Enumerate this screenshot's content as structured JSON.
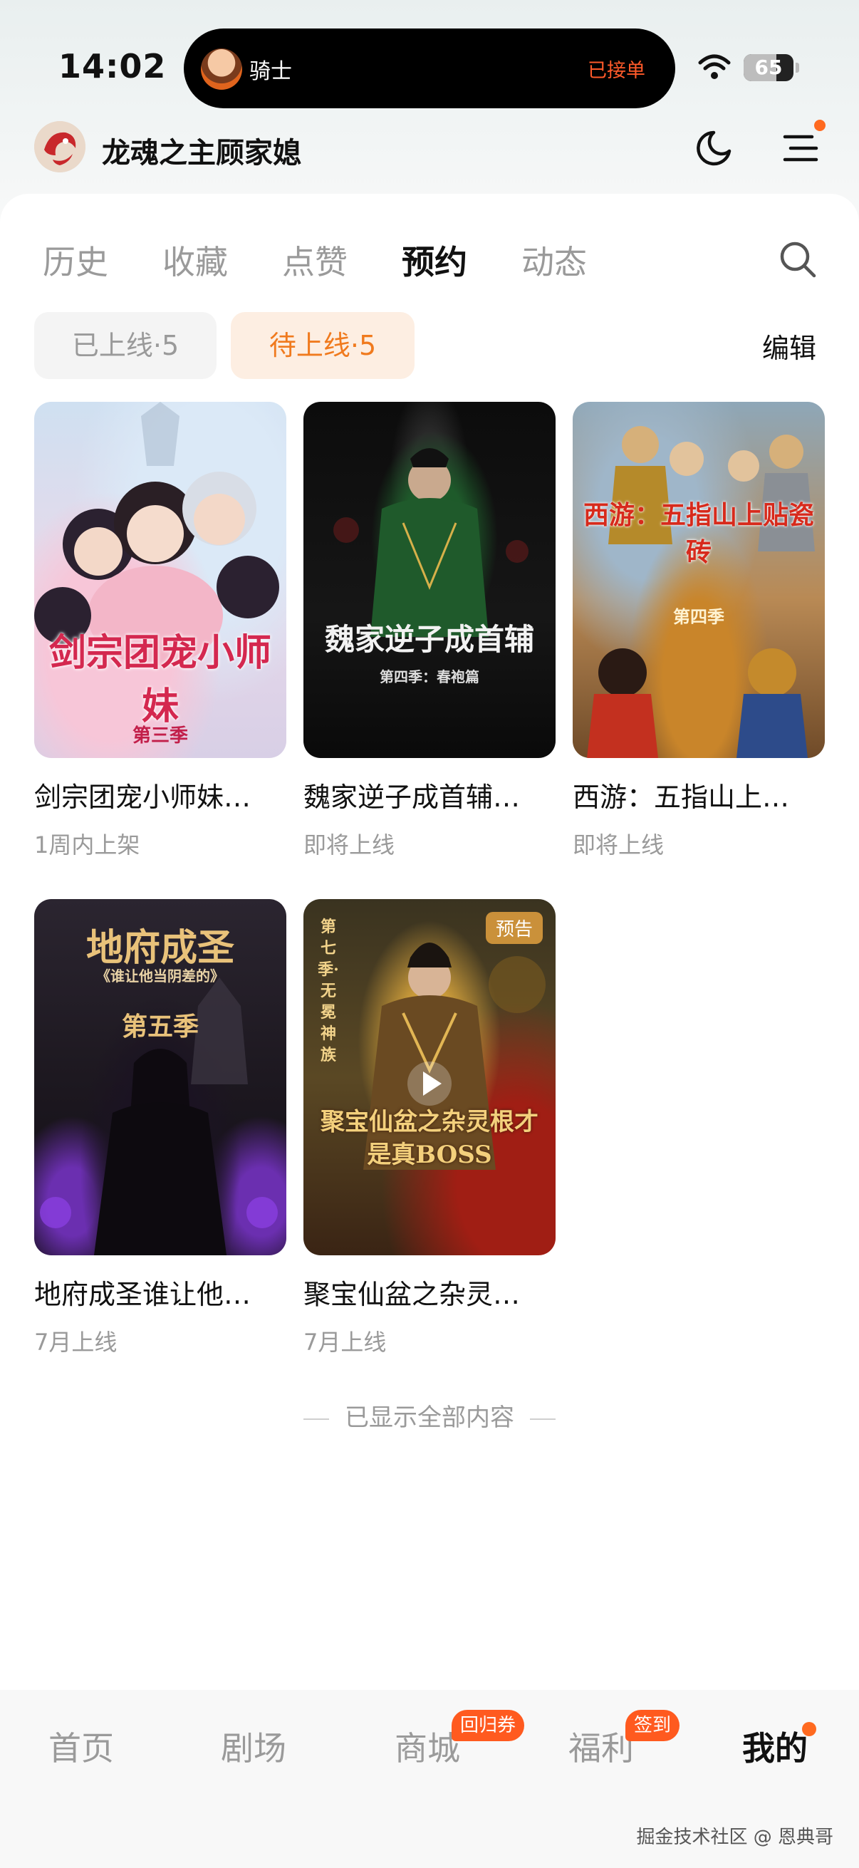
{
  "status_bar": {
    "time": "14:02",
    "live_activity": {
      "name": "骑士",
      "status": "已接单"
    },
    "battery": "65",
    "battery_level": 0.65
  },
  "header": {
    "username": "龙魂之主顾家媳",
    "icons": [
      "moon-icon",
      "menu-icon"
    ]
  },
  "tabs": [
    {
      "label": "历史",
      "active": false
    },
    {
      "label": "收藏",
      "active": false
    },
    {
      "label": "点赞",
      "active": false
    },
    {
      "label": "预约",
      "active": true
    },
    {
      "label": "动态",
      "active": false
    }
  ],
  "filters": {
    "online": "已上线·5",
    "upcoming": "待上线·5",
    "edit": "编辑"
  },
  "items": [
    {
      "title": "剑宗团宠小师妹…",
      "subtitle": "1周内上架",
      "poster_text": "剑宗团宠小师妹",
      "poster_sub": "第三季"
    },
    {
      "title": "魏家逆子成首辅…",
      "subtitle": "即将上线",
      "poster_text": "魏家逆子成首辅",
      "poster_sub": "第四季：春袍篇"
    },
    {
      "title": "西游：五指山上…",
      "subtitle": "即将上线",
      "poster_text": "西游：五指山上贴瓷砖",
      "poster_sub": "第四季"
    },
    {
      "title": "地府成圣谁让他…",
      "subtitle": "7月上线",
      "poster_text": "地府成圣",
      "poster_sub": "《谁让他当阴差的》",
      "poster_sub2": "第五季"
    },
    {
      "title": "聚宝仙盆之杂灵…",
      "subtitle": "7月上线",
      "poster_text": "聚宝仙盆之杂灵根才是真BOSS",
      "poster_side": "第七季·无冕神族",
      "badge": "预告"
    }
  ],
  "end_note": "已显示全部内容",
  "bottom_nav": [
    {
      "label": "首页",
      "active": false
    },
    {
      "label": "剧场",
      "active": false
    },
    {
      "label": "商城",
      "active": false,
      "badge": "回归券"
    },
    {
      "label": "福利",
      "active": false,
      "badge": "签到"
    },
    {
      "label": "我的",
      "active": true
    }
  ],
  "watermark": "掘金技术社区 @ 恩典哥",
  "colors": {
    "accent": "#f07a1e",
    "badge": "#ff5a1f",
    "text": "#111111",
    "muted": "#9a9a9a"
  }
}
